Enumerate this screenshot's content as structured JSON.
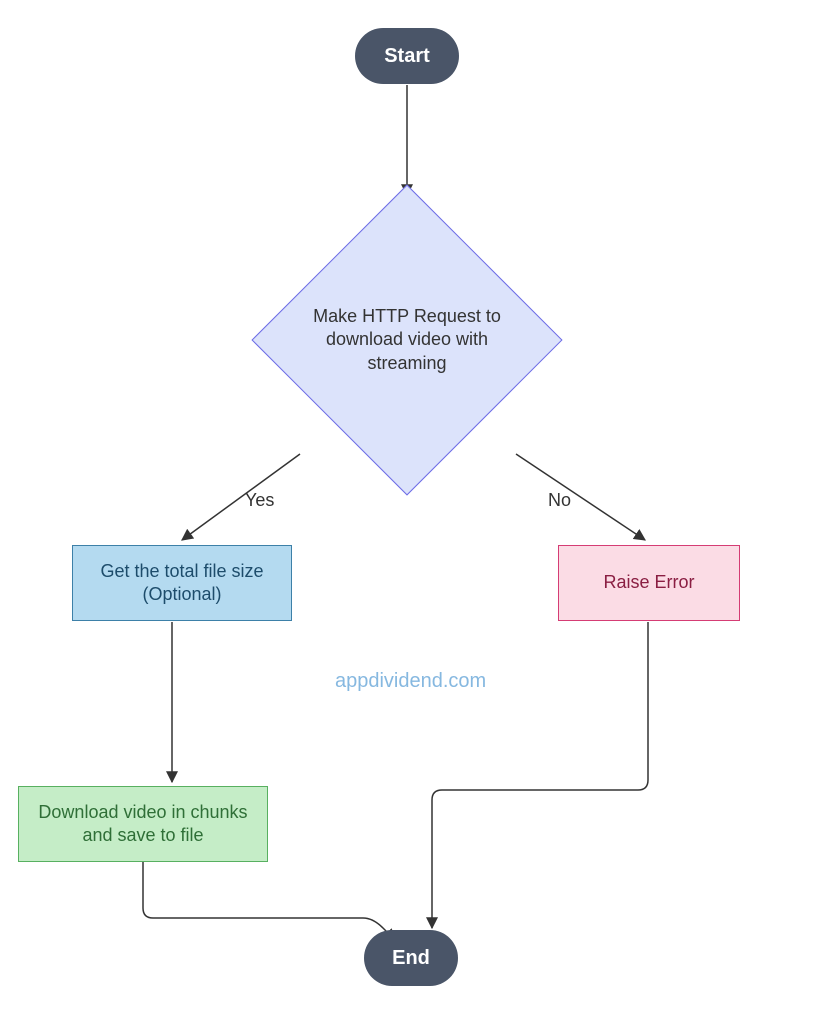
{
  "nodes": {
    "start": "Start",
    "decision": "Make HTTP Request to download video with streaming",
    "get_size": "Get the total file size (Optional)",
    "raise_error": "Raise Error",
    "download_chunks": "Download video in chunks and save to file",
    "end": "End"
  },
  "edges": {
    "yes": "Yes",
    "no": "No"
  },
  "watermark": "appdividend.com"
}
